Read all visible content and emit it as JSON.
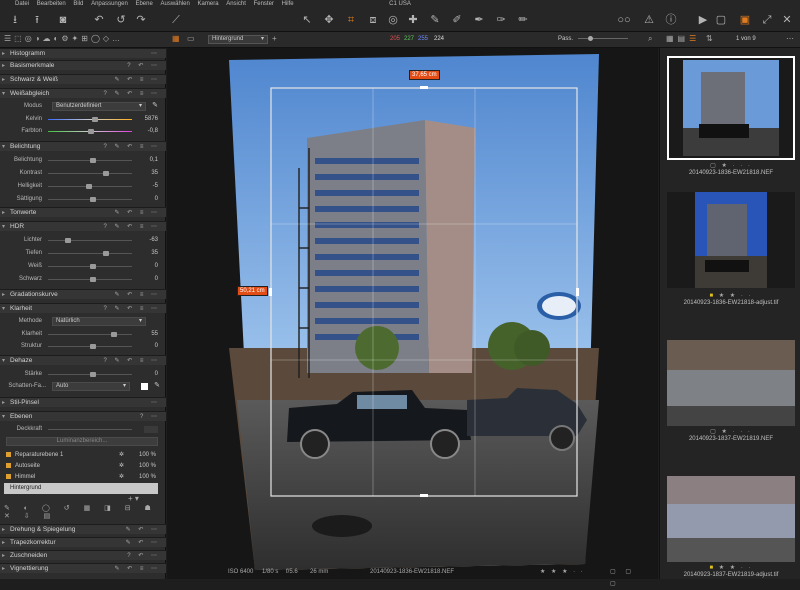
{
  "window_title": "C1 USA",
  "menu": [
    "Datei",
    "Bearbeiten",
    "Bild",
    "Anpassungen",
    "Ebene",
    "Auswählen",
    "Kamera",
    "Ansicht",
    "Fenster",
    "Hilfe"
  ],
  "subbar": {
    "layer_select": "Hintergrund",
    "rgb_r": "205",
    "rgb_g": "227",
    "rgb_b": "255",
    "rgb_l": "224",
    "fit_label": "Pass.",
    "counter": "1 von 9"
  },
  "colors": {
    "accent": "#e07b20",
    "red": "#e05050",
    "green": "#5ec45e",
    "blue": "#6a8cff"
  },
  "left": {
    "histogram": "Histogramm",
    "basis": "Basismerkmale",
    "sw": "Schwarz & Weiß",
    "wb": {
      "title": "Weißabgleich",
      "mode_label": "Modus",
      "mode_value": "Benutzerdefiniert",
      "kelvin_label": "Kelvin",
      "kelvin_value": "5876",
      "tint_label": "Farbton",
      "tint_value": "-0,8"
    },
    "exposure": {
      "title": "Belichtung",
      "rows": [
        {
          "label": "Belichtung",
          "value": "0,1",
          "pos": 0.5
        },
        {
          "label": "Kontrast",
          "value": "35",
          "pos": 0.65
        },
        {
          "label": "Helligkeit",
          "value": "-5",
          "pos": 0.45
        },
        {
          "label": "Sättigung",
          "value": "0",
          "pos": 0.5
        }
      ]
    },
    "tonwerte": "Tonwerte",
    "hdr": {
      "title": "HDR",
      "rows": [
        {
          "label": "Lichter",
          "value": "-63",
          "pos": 0.2
        },
        {
          "label": "Tiefen",
          "value": "35",
          "pos": 0.65
        },
        {
          "label": "Weiß",
          "value": "0",
          "pos": 0.5
        },
        {
          "label": "Schwarz",
          "value": "0",
          "pos": 0.5
        }
      ]
    },
    "gradation": "Gradationskurve",
    "clarity": {
      "title": "Klarheit",
      "method_label": "Methode",
      "method_value": "Natürlich",
      "rows": [
        {
          "label": "Klarheit",
          "value": "55",
          "pos": 0.75
        },
        {
          "label": "Struktur",
          "value": "0",
          "pos": 0.5
        }
      ]
    },
    "dehaze": {
      "title": "Dehaze",
      "strength_label": "Stärke",
      "strength_value": "0",
      "shadow_label": "Schatten-Fa...",
      "shadow_value": "Auto"
    },
    "stilpinsel": "Stil-Pinsel",
    "layers": {
      "title": "Ebenen",
      "opacity_label": "Deckkraft",
      "luminance_btn": "Luminanzbereich...",
      "items": [
        {
          "name": "Reparaturebene 1",
          "pct": "100 %"
        },
        {
          "name": "Autoseite",
          "pct": "100 %"
        },
        {
          "name": "Himmel",
          "pct": "100 %"
        }
      ],
      "background": "Hintergrund"
    },
    "rotation": "Drehung & Spiegelung",
    "keystone": "Trapezkorrektur",
    "crop": "Zuschneiden",
    "vignette": "Vignettierung"
  },
  "viewer": {
    "width_measure": "37,65 cm",
    "height_measure": "50,21 cm"
  },
  "status": {
    "iso": "ISO 6400",
    "shutter": "1/80 s",
    "aperture": "f/5.6",
    "focal": "26 mm",
    "filename": "20140923-1836-EW21818.NEF"
  },
  "browser": {
    "items": [
      {
        "name": "20140923-1836-EW21818.NEF"
      },
      {
        "name": "20140923-1836-EW21818-adjust.tif"
      },
      {
        "name": "20140923-1837-EW21819.NEF"
      },
      {
        "name": "20140923-1837-EW21819-adjust.tif"
      }
    ]
  }
}
